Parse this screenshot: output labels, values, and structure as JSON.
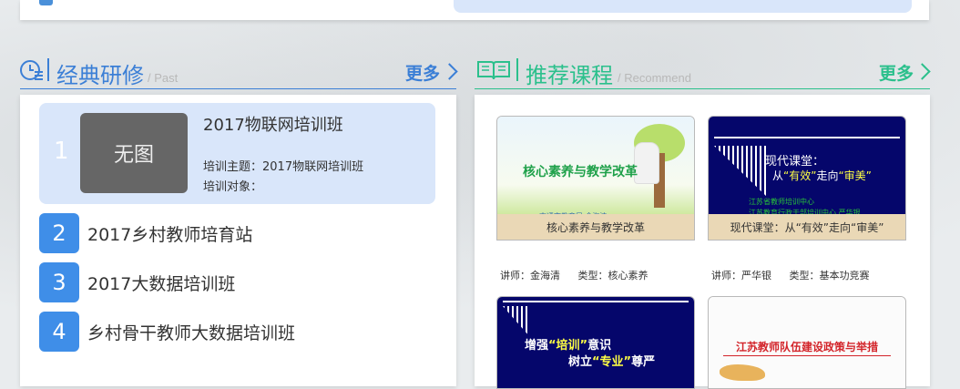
{
  "left_section": {
    "title": "经典研修",
    "subtitle": "/ Past",
    "more_label": "更多",
    "featured": {
      "number": "1",
      "thumb_text": "无图",
      "title": "2017物联网培训班",
      "line1": "培训主题：2017物联网培训班",
      "line2": "培训对象："
    },
    "items": [
      {
        "number": "2",
        "label": "2017乡村教师培育站"
      },
      {
        "number": "3",
        "label": "2017大数据培训班"
      },
      {
        "number": "4",
        "label": "乡村骨干教师大数据培训班"
      }
    ]
  },
  "right_section": {
    "title": "推荐课程",
    "subtitle": "/ Recommend",
    "more_label": "更多",
    "courses": [
      {
        "caption": "核心素养与教学改革",
        "lecturer": "讲师：金海清",
        "type": "类型：核心素养",
        "art_title": "核心素养与教学改革",
        "art_sub": "南通市教育局 金海清"
      },
      {
        "caption": "现代课堂：从“有效”走向“审美”",
        "lecturer": "讲师：严华银",
        "type": "类型：基本功竞赛",
        "art_line1": "现代课堂：",
        "art_line2_a": "从",
        "art_line2_b": "“有效”",
        "art_line2_c": "走向",
        "art_line2_d": "“审美”",
        "art_org1": "江苏省教师培训中心",
        "art_org2": "江苏教育行政干部培训中心  严华银"
      },
      {
        "art_line1_a": "增强",
        "art_line1_b": "“培训”",
        "art_line1_c": "意识",
        "art_line2_a": "树立",
        "art_line2_b": "“专业”",
        "art_line2_c": "尊严"
      },
      {
        "art_title": "江苏教师队伍建设政策与举措"
      }
    ]
  },
  "colors": {
    "left_accent": "#3b7fd6",
    "right_accent": "#2bc08c",
    "badge": "#3f8ee8",
    "featured_bg": "#d9e6fa"
  },
  "icons": {
    "left_header": "clock-list-icon",
    "right_header": "open-book-icon",
    "more": "chevron-right-icon"
  }
}
